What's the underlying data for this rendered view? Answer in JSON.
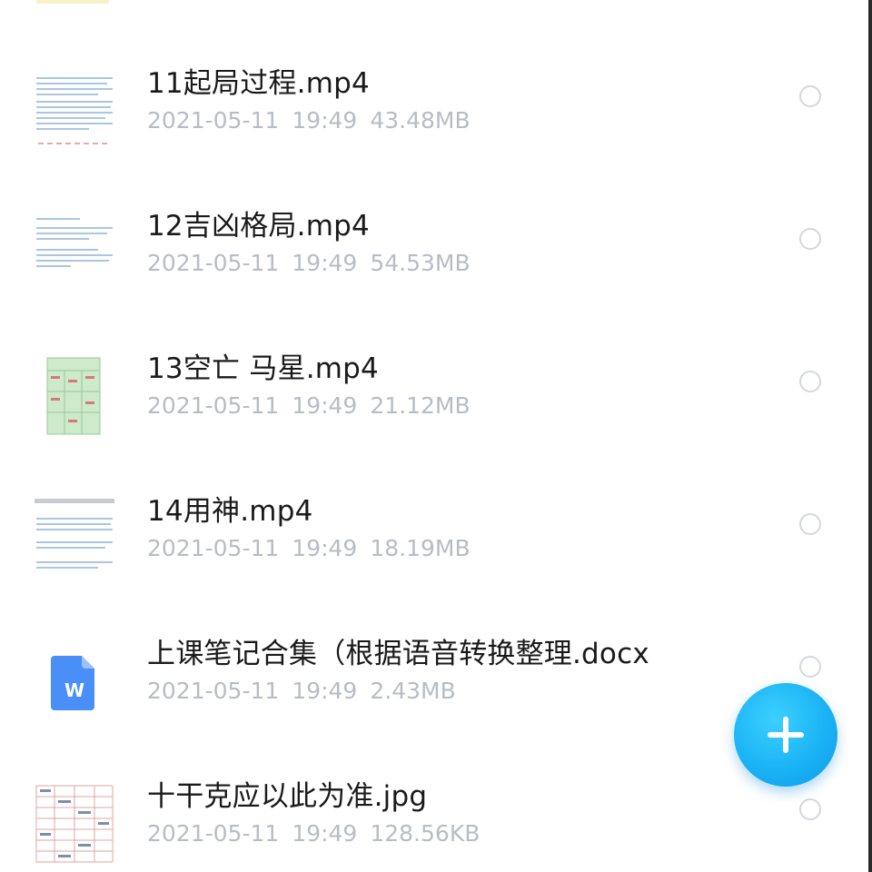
{
  "files": [
    {
      "name": "11起局过程.mp4",
      "date": "2021-05-11",
      "time": "19:49",
      "size": "43.48MB",
      "thumb": "document-preview-icon"
    },
    {
      "name": "12吉凶格局.mp4",
      "date": "2021-05-11",
      "time": "19:49",
      "size": "54.53MB",
      "thumb": "document-preview-icon"
    },
    {
      "name": "13空亡 马星.mp4",
      "date": "2021-05-11",
      "time": "19:49",
      "size": "21.12MB",
      "thumb": "grid-chart-preview-icon"
    },
    {
      "name": "14用神.mp4",
      "date": "2021-05-11",
      "time": "19:49",
      "size": "18.19MB",
      "thumb": "document-preview-icon"
    },
    {
      "name": "上课笔记合集（根据语音转换整理.docx",
      "date": "2021-05-11",
      "time": "19:49",
      "size": "2.43MB",
      "thumb": "word-doc-icon"
    },
    {
      "name": "十干克应以此为准.jpg",
      "date": "2021-05-11",
      "time": "19:49",
      "size": "128.56KB",
      "thumb": "table-image-preview-icon"
    }
  ],
  "fab": {
    "icon": "plus-icon"
  },
  "colors": {
    "accent": "#1ab3f5",
    "word_icon": "#4a8ff7",
    "meta_text": "#b8bcc4",
    "name_text": "#1a1a1a"
  }
}
